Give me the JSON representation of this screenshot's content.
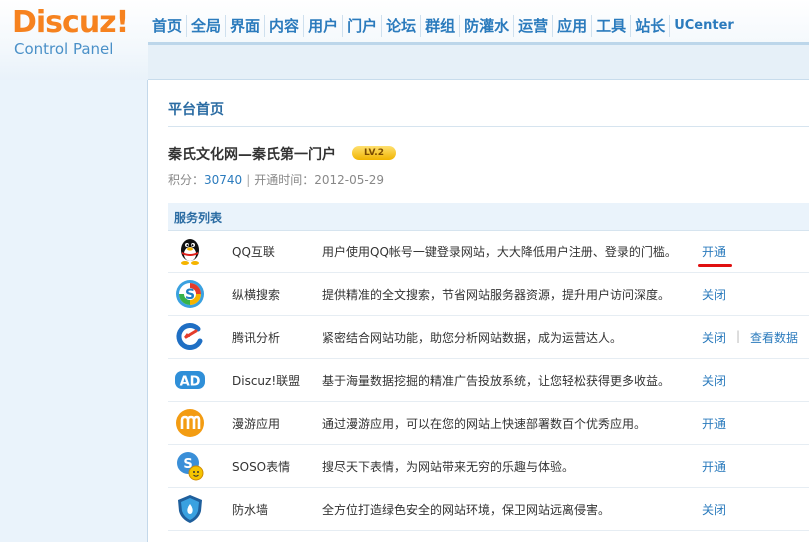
{
  "brand": {
    "name": "Discuz!",
    "subtitle": "Control Panel"
  },
  "topnav": [
    "首页",
    "全局",
    "界面",
    "内容",
    "用户",
    "门户",
    "论坛",
    "群组",
    "防灌水",
    "运营",
    "应用",
    "工具",
    "站长",
    "UCenter"
  ],
  "main": {
    "page_title": "平台首页",
    "site_name": "秦氏文化网—秦氏第一门户",
    "level_badge": "LV.2",
    "score_label": "积分：",
    "score_value": "30740",
    "meta_sep": "|",
    "open_time": "开通时间：2012-05-29",
    "service_header": "服务列表"
  },
  "services": [
    {
      "icon": "qq-penguin-icon",
      "name": "QQ互联",
      "desc": "用户使用QQ帐号一键登录网站，大大降低用户注册、登录的门槛。",
      "action": "开通"
    },
    {
      "icon": "soso-search-icon",
      "name": "纵横搜索",
      "desc": "提供精准的全文搜索，节省网站服务器资源，提升用户访问深度。",
      "action": "关闭"
    },
    {
      "icon": "analytics-arrow-icon",
      "name": "腾讯分析",
      "desc": "紧密结合网站功能，助您分析网站数据，成为运营达人。",
      "action": "关闭",
      "sep": "|",
      "extra": "查看数据"
    },
    {
      "icon": "ad-icon",
      "name": "Discuz!联盟",
      "desc": "基于海量数据挖掘的精准广告投放系统，让您轻松获得更多收益。",
      "action": "关闭"
    },
    {
      "icon": "manyou-m-icon",
      "name": "漫游应用",
      "desc": "通过漫游应用，可以在您的网站上快速部署数百个优秀应用。",
      "action": "开通"
    },
    {
      "icon": "soso-emoticon-icon",
      "name": "SOSO表情",
      "desc": "搜尽天下表情，为网站带来无穷的乐趣与体验。",
      "action": "开通"
    },
    {
      "icon": "firewall-shield-icon",
      "name": "防水墙",
      "desc": "全方位打造绿色安全的网站环境，保卫网站远离侵害。",
      "action": "关闭"
    }
  ],
  "colors": {
    "brand_orange": "#f6821f",
    "link_blue": "#2b7bbd",
    "title_blue": "#2b6ca3",
    "annotation_red": "#e01010"
  }
}
